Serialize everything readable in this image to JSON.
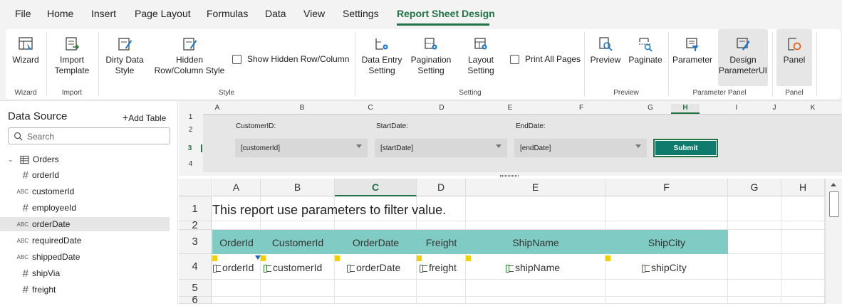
{
  "menu": {
    "items": [
      "File",
      "Home",
      "Insert",
      "Page Layout",
      "Formulas",
      "Data",
      "View",
      "Settings",
      "Report Sheet Design"
    ],
    "active": "Report Sheet Design"
  },
  "ribbon": {
    "wizard": "Wizard",
    "import_template": "Import Template",
    "dirty_data_style": "Dirty Data Style",
    "hidden_style": "Hidden Row/Column Style",
    "show_hidden": "Show Hidden Row/Column",
    "data_entry_setting": "Data Entry Setting",
    "pagination_setting": "Pagination Setting",
    "layout_setting": "Layout Setting",
    "print_all_pages": "Print All Pages",
    "preview": "Preview",
    "paginate": "Paginate",
    "parameter": "Parameter",
    "design_parameter_ui": "Design ParameterUI",
    "panel": "Panel",
    "groups": {
      "wizard": "Wizard",
      "import": "Import",
      "style": "Style",
      "setting": "Setting",
      "preview": "Preview",
      "parameter_panel": "Parameter Panel",
      "panel": "Panel"
    }
  },
  "data_source": {
    "title": "Data Source",
    "add_table": "Add Table",
    "search_placeholder": "Search",
    "table": "Orders",
    "fields": [
      {
        "name": "orderId",
        "type": "#"
      },
      {
        "name": "customerId",
        "type": "ABC"
      },
      {
        "name": "employeeId",
        "type": "#"
      },
      {
        "name": "orderDate",
        "type": "ABC"
      },
      {
        "name": "requiredDate",
        "type": "ABC"
      },
      {
        "name": "shippedDate",
        "type": "ABC"
      },
      {
        "name": "shipVia",
        "type": "#"
      },
      {
        "name": "freight",
        "type": "#"
      }
    ],
    "selected": "orderDate"
  },
  "param_panel": {
    "columns": [
      "A",
      "B",
      "C",
      "D",
      "E",
      "F",
      "G",
      "H",
      "I",
      "J",
      "K"
    ],
    "active_column": "H",
    "rows": [
      "1",
      "2",
      "3",
      "4"
    ],
    "customer_label": "CustomerID:",
    "customer_value": "[customerId]",
    "start_label": "StartDate:",
    "start_value": "[startDate]",
    "end_label": "EndDate:",
    "end_value": "[endDate]",
    "submit": "Submit"
  },
  "sheet": {
    "columns": [
      "A",
      "B",
      "C",
      "D",
      "E",
      "F",
      "G",
      "H"
    ],
    "active_column": "C",
    "rows": [
      "1",
      "2",
      "3",
      "4",
      "5",
      "6"
    ],
    "title": "This report use parameters to filter value.",
    "headers": [
      "OrderId",
      "CustomerId",
      "OrderDate",
      "Freight",
      "ShipName",
      "ShipCity"
    ],
    "fields": [
      "orderId",
      "customerId",
      "orderDate",
      "freight",
      "shipName",
      "shipCity"
    ]
  },
  "colors": {
    "accent": "#217346",
    "header_band": "#80cbc4",
    "submit": "#0f7b6c"
  }
}
